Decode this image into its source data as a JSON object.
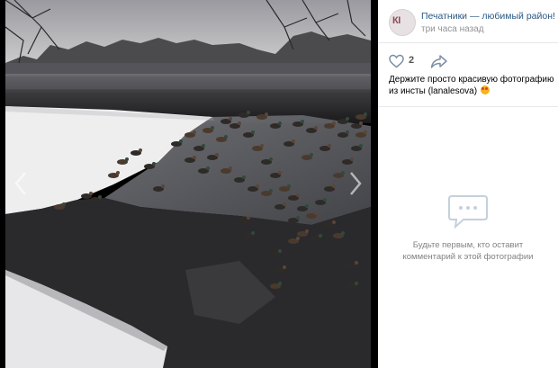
{
  "viewer": {
    "photo_alt": "Утки на замерзшем пруду",
    "prev_icon": "chevron-left-icon",
    "next_icon": "chevron-right-icon"
  },
  "post": {
    "author_name": "Печатники — любимый район!",
    "author_avatar_text": "КI",
    "time": "три часа назад",
    "likes": "2",
    "like_icon": "heart-icon",
    "share_icon": "share-arrow-icon",
    "caption": "Держите просто красивую фотографию из инсты (lanalesova)"
  },
  "comments": {
    "empty_icon": "comment-bubble-icon",
    "empty_text": "Будьте первым, кто оставит комментарий к этой фотографии"
  },
  "colors": {
    "link": "#2a5885",
    "muted": "#939393",
    "background": "#000000"
  }
}
